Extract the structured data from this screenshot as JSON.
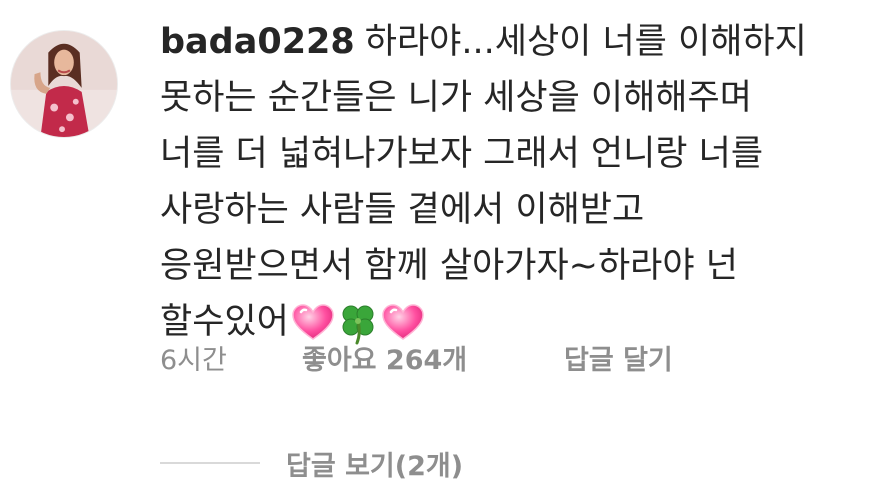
{
  "comment": {
    "username": "bada0228",
    "lines": [
      "하라야...세상이 너를 이해하지",
      "못하는 순간들은 니가 세상을 이해해주며",
      "너를 더 넓혀나가보자  그래서 언니랑 너를",
      "사랑하는 사람들 곁에서 이해받고",
      "응원받으면서 함께 살아가자~하라야 넌",
      "할수있어"
    ],
    "emojis": [
      "heart-with-sparkles-icon",
      "four-leaf-clover-icon",
      "heart-with-sparkles-icon"
    ],
    "time_ago": "6시간",
    "likes": "좋아요 264개",
    "reply_label": "답글 달기",
    "view_replies_label": "답글 보기(2개)"
  },
  "colors": {
    "text": "#262626",
    "meta": "#8e8e8e",
    "divider": "#d9d9d9",
    "heart": "#ff4fa0",
    "clover": "#3aa63a"
  }
}
